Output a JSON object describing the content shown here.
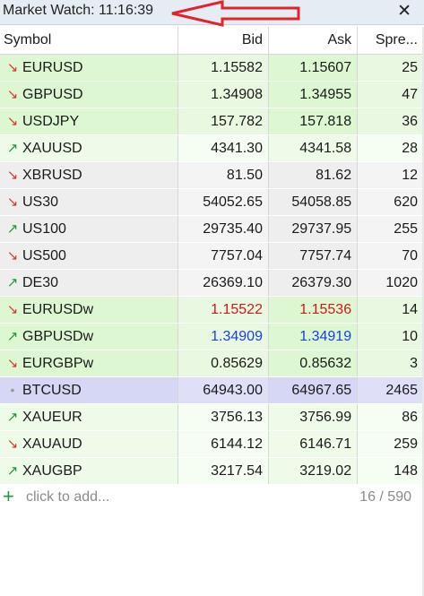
{
  "window": {
    "title": "Market Watch: 11:16:39",
    "close_glyph": "✕"
  },
  "columns": {
    "symbol": "Symbol",
    "bid": "Bid",
    "ask": "Ask",
    "spread": "Spre..."
  },
  "rows": [
    {
      "symbol": "EURUSD",
      "dir": "down",
      "bid": "1.15582",
      "ask": "1.15607",
      "spread": "25",
      "bg": "green",
      "bid_color": "",
      "ask_color": ""
    },
    {
      "symbol": "GBPUSD",
      "dir": "down",
      "bid": "1.34908",
      "ask": "1.34955",
      "spread": "47",
      "bg": "green",
      "bid_color": "",
      "ask_color": ""
    },
    {
      "symbol": "USDJPY",
      "dir": "down",
      "bid": "157.782",
      "ask": "157.818",
      "spread": "36",
      "bg": "green",
      "bid_color": "",
      "ask_color": ""
    },
    {
      "symbol": "XAUUSD",
      "dir": "up",
      "bid": "4341.30",
      "ask": "4341.58",
      "spread": "28",
      "bg": "light",
      "bid_color": "",
      "ask_color": ""
    },
    {
      "symbol": "XBRUSD",
      "dir": "down",
      "bid": "81.50",
      "ask": "81.62",
      "spread": "12",
      "bg": "grey",
      "bid_color": "",
      "ask_color": ""
    },
    {
      "symbol": "US30",
      "dir": "down",
      "bid": "54052.65",
      "ask": "54058.85",
      "spread": "620",
      "bg": "grey",
      "bid_color": "",
      "ask_color": ""
    },
    {
      "symbol": "US100",
      "dir": "up",
      "bid": "29735.40",
      "ask": "29737.95",
      "spread": "255",
      "bg": "grey",
      "bid_color": "",
      "ask_color": ""
    },
    {
      "symbol": "US500",
      "dir": "down",
      "bid": "7757.04",
      "ask": "7757.74",
      "spread": "70",
      "bg": "grey",
      "bid_color": "",
      "ask_color": ""
    },
    {
      "symbol": "DE30",
      "dir": "up",
      "bid": "26369.10",
      "ask": "26379.30",
      "spread": "1020",
      "bg": "grey",
      "bid_color": "",
      "ask_color": ""
    },
    {
      "symbol": "EURUSDw",
      "dir": "down",
      "bid": "1.15522",
      "ask": "1.15536",
      "spread": "14",
      "bg": "green",
      "bid_color": "red",
      "ask_color": "red"
    },
    {
      "symbol": "GBPUSDw",
      "dir": "up",
      "bid": "1.34909",
      "ask": "1.34919",
      "spread": "10",
      "bg": "green",
      "bid_color": "blue",
      "ask_color": "blue"
    },
    {
      "symbol": "EURGBPw",
      "dir": "down",
      "bid": "0.85629",
      "ask": "0.85632",
      "spread": "3",
      "bg": "green",
      "bid_color": "",
      "ask_color": ""
    },
    {
      "symbol": "BTCUSD",
      "dir": "none",
      "bid": "64943.00",
      "ask": "64967.65",
      "spread": "2465",
      "bg": "purple",
      "bid_color": "",
      "ask_color": ""
    },
    {
      "symbol": "XAUEUR",
      "dir": "up",
      "bid": "3756.13",
      "ask": "3756.99",
      "spread": "86",
      "bg": "light",
      "bid_color": "",
      "ask_color": ""
    },
    {
      "symbol": "XAUAUD",
      "dir": "down",
      "bid": "6144.12",
      "ask": "6146.71",
      "spread": "259",
      "bg": "light",
      "bid_color": "",
      "ask_color": ""
    },
    {
      "symbol": "XAUGBP",
      "dir": "up",
      "bid": "3217.54",
      "ask": "3219.02",
      "spread": "148",
      "bg": "light",
      "bid_color": "",
      "ask_color": ""
    }
  ],
  "footer": {
    "add_label": "click to add...",
    "count": "16 / 590"
  },
  "icons": {
    "down": "arrow-down-right-icon",
    "up": "arrow-up-right-icon",
    "none": "dot-icon",
    "add": "plus-icon",
    "close": "close-icon"
  },
  "colors": {
    "down": "#d23b2a",
    "up": "#1a9a3a",
    "price_red": "#d01818",
    "price_blue": "#1a3ee0",
    "annotation": "#e0242a"
  }
}
